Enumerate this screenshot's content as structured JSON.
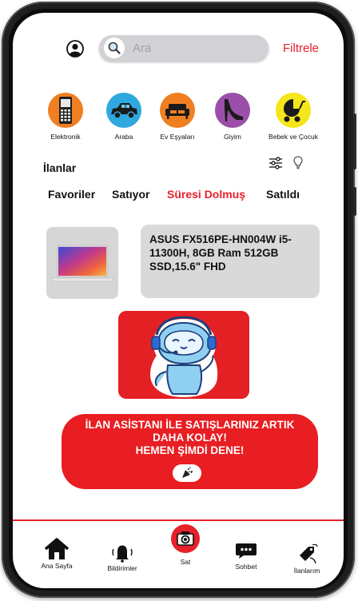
{
  "header": {
    "search_placeholder": "Ara",
    "filter_label": "Filtrele"
  },
  "categories": [
    {
      "label": "Elektronik",
      "icon": "smartphone-icon",
      "color": "#f07f22"
    },
    {
      "label": "Araba",
      "icon": "car-icon",
      "color": "#2fa8e0"
    },
    {
      "label": "Ev Eşyaları",
      "icon": "sofa-icon",
      "color": "#f07f22"
    },
    {
      "label": "Giyim",
      "icon": "high-heel-icon",
      "color": "#9b4fa8"
    },
    {
      "label": "Bebek ve Çocuk",
      "icon": "stroller-icon",
      "color": "#f5e51b"
    }
  ],
  "listings": {
    "title": "İlanlar",
    "tabs": [
      "Favoriler",
      "Satıyor",
      "Süresi Dolmuş",
      "Satıldı"
    ],
    "active_tab": "Süresi Dolmuş"
  },
  "product": {
    "title": "ASUS FX516PE-HN004W i5-11300H, 8GB Ram 512GB SSD,15.6\" FHD"
  },
  "banner": {
    "line1": "İLAN ASİSTANI İLE SATIŞLARINIZ ARTIK",
    "line2": "DAHA KOLAY!",
    "line3": "HEMEN ŞİMDİ DENE!",
    "button_icon": "party-popper-icon"
  },
  "bottom_nav": [
    {
      "label": "Ana Sayfa",
      "icon": "home-icon"
    },
    {
      "label": "Bildirimler",
      "icon": "bell-icon"
    },
    {
      "label": "Sat",
      "icon": "camera-icon"
    },
    {
      "label": "Sohbet",
      "icon": "chat-icon"
    },
    {
      "label": "İlanlarım",
      "icon": "tag-icon"
    }
  ],
  "colors": {
    "accent": "#e8202a",
    "search_bg": "#d2d2d6",
    "card_bg": "#d9d9d9"
  }
}
